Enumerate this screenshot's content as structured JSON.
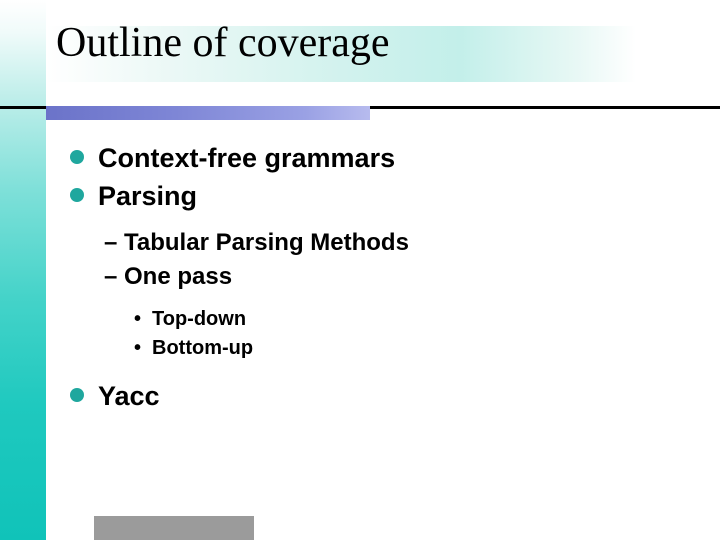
{
  "title": "Outline of coverage",
  "bullets": {
    "lvl1": [
      "Context-free grammars",
      "Parsing",
      "Yacc"
    ],
    "parsing_sub": [
      "Tabular Parsing Methods",
      "One pass"
    ],
    "onepass_sub": [
      "Top-down",
      "Bottom-up"
    ]
  },
  "colors": {
    "accent_teal": "#1fa79e",
    "rule_blue": "#6b73c9"
  }
}
